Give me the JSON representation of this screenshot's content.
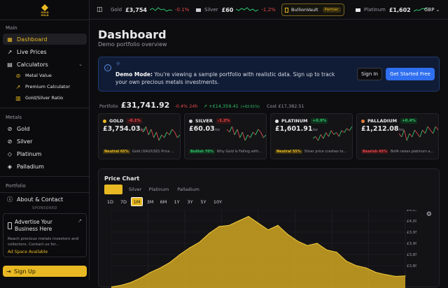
{
  "sidebar": {
    "logo_text": "GOLD GOLD",
    "sections": {
      "main": "Main",
      "metals": "Metals",
      "portfolio": "Portfolio"
    },
    "main_items": [
      {
        "label": "Dashboard",
        "icon": "grid-icon"
      },
      {
        "label": "Live Prices",
        "icon": "trend-icon"
      },
      {
        "label": "Calculators",
        "icon": "calculator-icon"
      }
    ],
    "calculator_items": [
      {
        "label": "Metal Value"
      },
      {
        "label": "Premium Calculator"
      },
      {
        "label": "Gold/Silver Ratio"
      }
    ],
    "metal_items": [
      {
        "label": "Gold"
      },
      {
        "label": "Silver"
      },
      {
        "label": "Platinum"
      },
      {
        "label": "Palladium"
      }
    ],
    "about": "About & Contact",
    "sponsored": "SPONSORED",
    "ad": {
      "title": "Advertise Your Business Here",
      "desc": "Reach precious metals investors and collectors. Contact us for...",
      "link": "Ad Space Available"
    },
    "signup": "Sign Up"
  },
  "topbar": {
    "ticker": [
      {
        "name": "Gold",
        "price": "£3,754",
        "change": "-0.1%"
      },
      {
        "name": "Silver",
        "price": "£60",
        "change": "-1.2%"
      },
      {
        "name": "Platinum",
        "price": "£1,602"
      }
    ],
    "partner_name": "BullionVault",
    "partner_badge": "Partner",
    "currency": "GBP"
  },
  "page": {
    "title": "Dashboard",
    "subtitle": "Demo portfolio overview"
  },
  "banner": {
    "title": "Demo Mode:",
    "text": "You're viewing a sample portfolio with realistic data. Sign up to track your own precious metals investments.",
    "signin": "Sign In",
    "start": "Get Started Free"
  },
  "portfolio": {
    "label": "Portfolio",
    "value": "£31,741.92",
    "change_24h": "-0.4% 24h",
    "gain": "+£14,359.41",
    "gain_pct": "(+82.61%)",
    "cost": "Cost £17,382.51"
  },
  "metal_cards": [
    {
      "name": "GOLD",
      "change": "-0.1%",
      "dir": "red",
      "price": "£3,754.03",
      "unit": "/oz",
      "sentiment": "Neutral 65%",
      "stype": "neutral",
      "news": "Gold (XAU/USD) Price ...",
      "color": "#e8b923",
      "spark": [
        10,
        9,
        11,
        8,
        10,
        7,
        9,
        6,
        8,
        7,
        9,
        8,
        10,
        9,
        7,
        8
      ]
    },
    {
      "name": "SILVER",
      "change": "-1.2%",
      "dir": "red",
      "price": "£60.03",
      "unit": "/oz",
      "sentiment": "Bullish 70%",
      "stype": "bull",
      "news": "Why Gold Is Falling with...",
      "color": "#cfcfd4",
      "spark": [
        9,
        8,
        10,
        7,
        9,
        6,
        8,
        5,
        7,
        6,
        8,
        7,
        9,
        8,
        6,
        7
      ]
    },
    {
      "name": "PLATINUM",
      "change": "+0.9%",
      "dir": "green",
      "price": "£1,601.91",
      "unit": "/oz",
      "sentiment": "Neutral 55%",
      "stype": "neutral",
      "news": "Silver price crashes to...",
      "color": "#e8e8ea",
      "spark": [
        6,
        7,
        5,
        8,
        6,
        9,
        7,
        10,
        8,
        9,
        7,
        10,
        9,
        11,
        10,
        12
      ]
    },
    {
      "name": "PALLADIUM",
      "change": "+0.4%",
      "dir": "green",
      "price": "£1,212.08",
      "unit": "/oz",
      "sentiment": "Bearish 45%",
      "stype": "bear",
      "news": "BofA raises platinum a...",
      "color": "#e07b39",
      "spark": [
        8,
        7,
        9,
        6,
        8,
        7,
        9,
        8,
        7,
        9,
        8,
        10,
        9,
        8,
        10,
        9
      ]
    }
  ],
  "chart_panel": {
    "title": "Price Chart",
    "metal_tabs": [
      "Gold",
      "Silver",
      "Platinum",
      "Palladium"
    ],
    "period_tabs": [
      "1D",
      "7D",
      "1M",
      "3M",
      "6M",
      "1Y",
      "3Y",
      "5Y",
      "10Y"
    ],
    "active_period": "1M"
  },
  "chart_data": {
    "type": "area",
    "series": [
      {
        "name": "Gold",
        "values": [
          3705,
          3712,
          3725,
          3745,
          3770,
          3790,
          3815,
          3850,
          3880,
          3905,
          3945,
          3975,
          3980,
          4000,
          4020,
          3990,
          3960,
          3980,
          3940,
          3910,
          3890,
          3900,
          3870,
          3860,
          3820,
          3800,
          3790,
          3770,
          3760,
          3752,
          3754
        ]
      }
    ],
    "y_ticks": [
      "£4,050",
      "£4,000.00",
      "£3,950.00",
      "£3,900.00",
      "£3,850.00",
      "£3,800.00"
    ],
    "ylim": [
      3700,
      4050
    ],
    "grid": true
  },
  "colors": {
    "accent": "#e8b923",
    "up": "#30c46c",
    "down": "#e5484d",
    "info": "#2f6ff0"
  }
}
